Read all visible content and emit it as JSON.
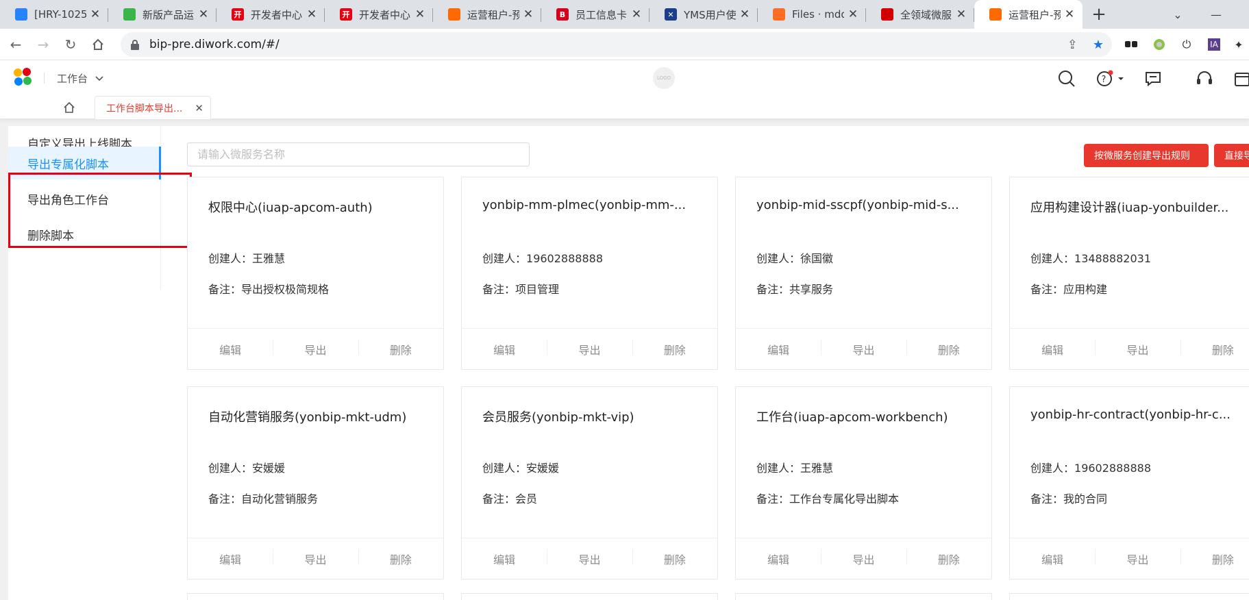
{
  "browser": {
    "tabs": [
      {
        "title": "[HRY-1025",
        "favicon": "jira-icon",
        "color": "#2684ff"
      },
      {
        "title": "新版产品运",
        "favicon": "leaf-icon",
        "color": "#3ab54a"
      },
      {
        "title": "开发者中心",
        "favicon": "kai-icon",
        "color": "#e60012",
        "glyph": "开"
      },
      {
        "title": "开发者中心",
        "favicon": "kai-icon",
        "color": "#e60012",
        "glyph": "开"
      },
      {
        "title": "运营租户-预",
        "favicon": "yonyou-icon",
        "color": "#ff6a00"
      },
      {
        "title": "员工信息卡",
        "favicon": "b-icon",
        "color": "#d6001c",
        "glyph": "B"
      },
      {
        "title": "YMS用户使",
        "favicon": "yms-icon",
        "color": "#1a3e8c",
        "glyph": "✕"
      },
      {
        "title": "Files · mdd",
        "favicon": "gitlab-icon",
        "color": "#fc6d26"
      },
      {
        "title": "全领域微服",
        "favicon": "red-circle-icon",
        "color": "#d40000"
      },
      {
        "title": "运营租户-预",
        "favicon": "yonyou-icon",
        "color": "#ff6a00",
        "active": true
      }
    ],
    "url": "bip-pre.diwork.com/#/"
  },
  "header": {
    "workspace": "工作台",
    "center_logo": "LOGO"
  },
  "app_tabs": {
    "open_tab": "工作台脚本导出..."
  },
  "sidebar": {
    "items": [
      {
        "label": "自定义导出上线脚本",
        "active": false
      },
      {
        "label": "导出专属化脚本",
        "active": true
      },
      {
        "label": "导出角色工作台",
        "active": false
      },
      {
        "label": "删除脚本",
        "active": false
      }
    ]
  },
  "toolbar": {
    "search_placeholder": "请输入微服务名称",
    "create_rule_button": "按微服务创建导出规则",
    "direct_button": "直接导"
  },
  "labels": {
    "creator": "创建人：",
    "note": "备注：",
    "edit": "编辑",
    "export": "导出",
    "delete": "删除"
  },
  "cards": [
    {
      "title": "权限中心(iuap-apcom-auth)",
      "creator": "王雅慧",
      "note": "导出授权极简规格"
    },
    {
      "title": "yonbip-mm-plmec(yonbip-mm-...",
      "creator": "19602888888",
      "note": "项目管理"
    },
    {
      "title": "yonbip-mid-sscpf(yonbip-mid-s...",
      "creator": "徐国徽",
      "note": "共享服务"
    },
    {
      "title": "应用构建设计器(iuap-yonbuilder...",
      "creator": "13488882031",
      "note": "应用构建"
    },
    {
      "title": "自动化营销服务(yonbip-mkt-udm)",
      "creator": "安媛媛",
      "note": "自动化营销服务"
    },
    {
      "title": "会员服务(yonbip-mkt-vip)",
      "creator": "安媛媛",
      "note": "会员"
    },
    {
      "title": "工作台(iuap-apcom-workbench)",
      "creator": "王雅慧",
      "note": "工作台专属化导出脚本"
    },
    {
      "title": "yonbip-hr-contract(yonbip-hr-c...",
      "creator": "19602888888",
      "note": "我的合同"
    }
  ]
}
